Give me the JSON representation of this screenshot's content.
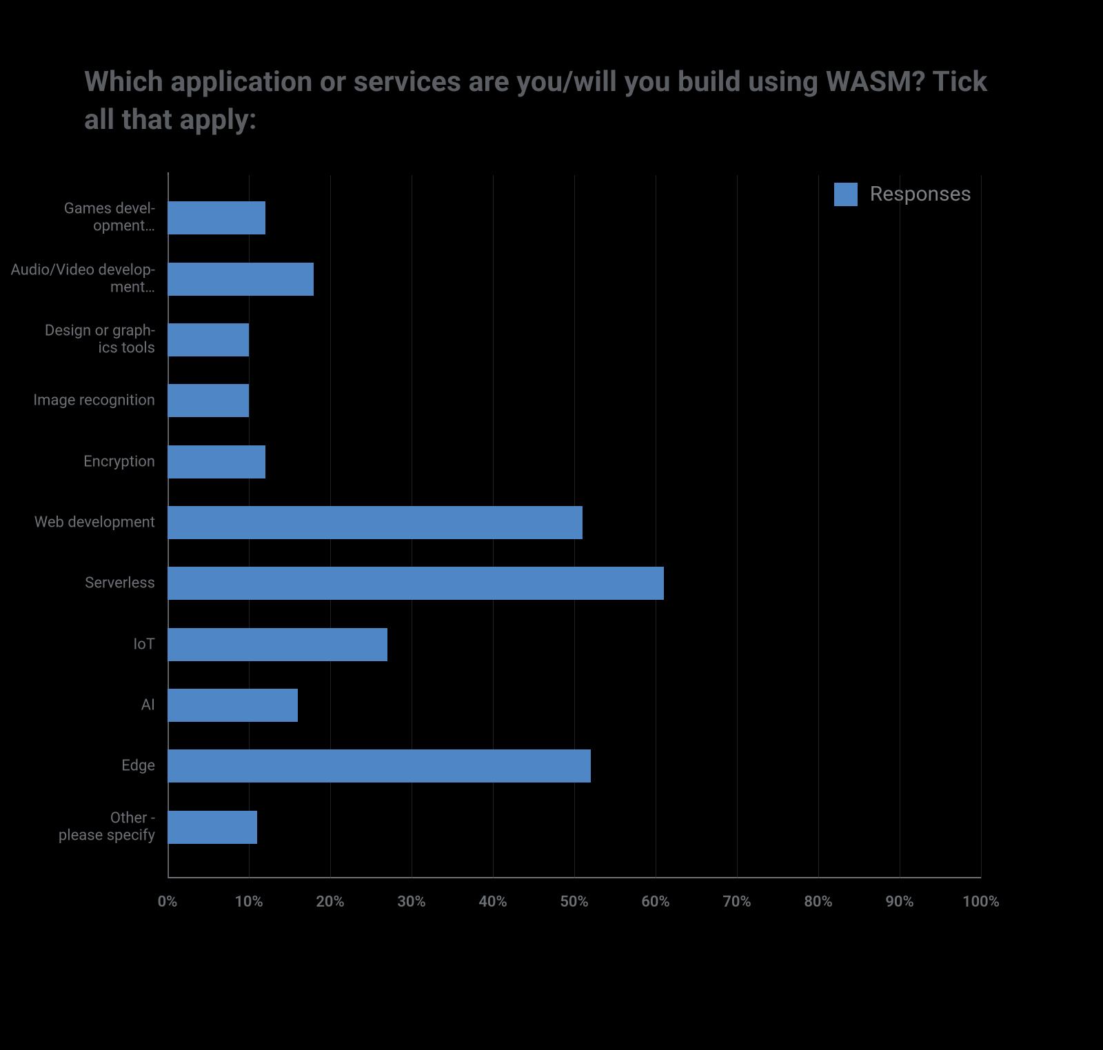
{
  "title": "Which application or services are you/will you build using WASM? Tick all that apply:",
  "legend": {
    "label": "Responses"
  },
  "axis": {
    "ticks": [
      0,
      10,
      20,
      30,
      40,
      50,
      60,
      70,
      80,
      90,
      100
    ],
    "tick_labels": [
      "0%",
      "10%",
      "20%",
      "30%",
      "40%",
      "50%",
      "60%",
      "70%",
      "80%",
      "90%",
      "100%"
    ],
    "xmax": 100
  },
  "bars": [
    {
      "label": "Games devel-\nopment…",
      "value": 12
    },
    {
      "label": "Audio/Video develop-\nment…",
      "value": 18
    },
    {
      "label": "Design or graph-\nics tools",
      "value": 10
    },
    {
      "label": "Image recognition",
      "value": 10
    },
    {
      "label": "Encryption",
      "value": 12
    },
    {
      "label": "Web development",
      "value": 51
    },
    {
      "label": "Serverless",
      "value": 61
    },
    {
      "label": "IoT",
      "value": 27
    },
    {
      "label": "AI",
      "value": 16
    },
    {
      "label": "Edge",
      "value": 52
    },
    {
      "label": "Other -\nplease specify",
      "value": 11
    }
  ],
  "colors": {
    "bar": "#4e86c6",
    "grid": "#3a3d42",
    "axis": "#6d7176",
    "title": "#5b5e63"
  },
  "chart_data": {
    "type": "bar",
    "orientation": "horizontal",
    "title": "Which application or services are you/will you build using WASM? Tick all that apply:",
    "xlabel": "",
    "ylabel": "",
    "xlim": [
      0,
      100
    ],
    "x_unit": "percent",
    "categories": [
      "Games development…",
      "Audio/Video development…",
      "Design or graphics tools",
      "Image recognition",
      "Encryption",
      "Web development",
      "Serverless",
      "IoT",
      "AI",
      "Edge",
      "Other - please specify"
    ],
    "series": [
      {
        "name": "Responses",
        "values": [
          12,
          18,
          10,
          10,
          12,
          51,
          61,
          27,
          16,
          52,
          11
        ]
      }
    ],
    "x_ticks": [
      0,
      10,
      20,
      30,
      40,
      50,
      60,
      70,
      80,
      90,
      100
    ],
    "x_tick_labels": [
      "0%",
      "10%",
      "20%",
      "30%",
      "40%",
      "50%",
      "60%",
      "70%",
      "80%",
      "90%",
      "100%"
    ],
    "legend_position": "top-right",
    "grid": {
      "x": true,
      "y": false
    }
  }
}
